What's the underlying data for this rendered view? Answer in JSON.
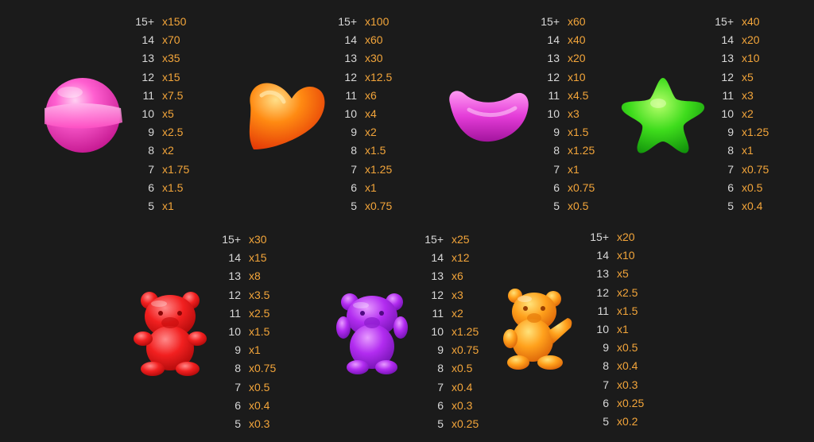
{
  "colors": {
    "background": "#1b1b1b",
    "count_text": "#d8d8d8",
    "multiplier_text": "#f3a53a"
  },
  "symbols": [
    {
      "icon": "pink-lollipop-icon",
      "rows": [
        {
          "count": "15+",
          "mult": "x150"
        },
        {
          "count": "14",
          "mult": "x70"
        },
        {
          "count": "13",
          "mult": "x35"
        },
        {
          "count": "12",
          "mult": "x15"
        },
        {
          "count": "11",
          "mult": "x7.5"
        },
        {
          "count": "10",
          "mult": "x5"
        },
        {
          "count": "9",
          "mult": "x2.5"
        },
        {
          "count": "8",
          "mult": "x2"
        },
        {
          "count": "7",
          "mult": "x1.75"
        },
        {
          "count": "6",
          "mult": "x1.5"
        },
        {
          "count": "5",
          "mult": "x1"
        }
      ]
    },
    {
      "icon": "orange-heart-candy-icon",
      "rows": [
        {
          "count": "15+",
          "mult": "x100"
        },
        {
          "count": "14",
          "mult": "x60"
        },
        {
          "count": "13",
          "mult": "x30"
        },
        {
          "count": "12",
          "mult": "x12.5"
        },
        {
          "count": "11",
          "mult": "x6"
        },
        {
          "count": "10",
          "mult": "x4"
        },
        {
          "count": "9",
          "mult": "x2"
        },
        {
          "count": "8",
          "mult": "x1.5"
        },
        {
          "count": "7",
          "mult": "x1.25"
        },
        {
          "count": "6",
          "mult": "x1"
        },
        {
          "count": "5",
          "mult": "x0.75"
        }
      ]
    },
    {
      "icon": "magenta-jellybean-icon",
      "rows": [
        {
          "count": "15+",
          "mult": "x60"
        },
        {
          "count": "14",
          "mult": "x40"
        },
        {
          "count": "13",
          "mult": "x20"
        },
        {
          "count": "12",
          "mult": "x10"
        },
        {
          "count": "11",
          "mult": "x4.5"
        },
        {
          "count": "10",
          "mult": "x3"
        },
        {
          "count": "9",
          "mult": "x1.5"
        },
        {
          "count": "8",
          "mult": "x1.25"
        },
        {
          "count": "7",
          "mult": "x1"
        },
        {
          "count": "6",
          "mult": "x0.75"
        },
        {
          "count": "5",
          "mult": "x0.5"
        }
      ]
    },
    {
      "icon": "green-star-candy-icon",
      "rows": [
        {
          "count": "15+",
          "mult": "x40"
        },
        {
          "count": "14",
          "mult": "x20"
        },
        {
          "count": "13",
          "mult": "x10"
        },
        {
          "count": "12",
          "mult": "x5"
        },
        {
          "count": "11",
          "mult": "x3"
        },
        {
          "count": "10",
          "mult": "x2"
        },
        {
          "count": "9",
          "mult": "x1.25"
        },
        {
          "count": "8",
          "mult": "x1"
        },
        {
          "count": "7",
          "mult": "x0.75"
        },
        {
          "count": "6",
          "mult": "x0.5"
        },
        {
          "count": "5",
          "mult": "x0.4"
        }
      ]
    },
    {
      "icon": "red-gummy-bear-icon",
      "rows": [
        {
          "count": "15+",
          "mult": "x30"
        },
        {
          "count": "14",
          "mult": "x15"
        },
        {
          "count": "13",
          "mult": "x8"
        },
        {
          "count": "12",
          "mult": "x3.5"
        },
        {
          "count": "11",
          "mult": "x2.5"
        },
        {
          "count": "10",
          "mult": "x1.5"
        },
        {
          "count": "9",
          "mult": "x1"
        },
        {
          "count": "8",
          "mult": "x0.75"
        },
        {
          "count": "7",
          "mult": "x0.5"
        },
        {
          "count": "6",
          "mult": "x0.4"
        },
        {
          "count": "5",
          "mult": "x0.3"
        }
      ]
    },
    {
      "icon": "purple-gummy-bear-icon",
      "rows": [
        {
          "count": "15+",
          "mult": "x25"
        },
        {
          "count": "14",
          "mult": "x12"
        },
        {
          "count": "13",
          "mult": "x6"
        },
        {
          "count": "12",
          "mult": "x3"
        },
        {
          "count": "11",
          "mult": "x2"
        },
        {
          "count": "10",
          "mult": "x1.25"
        },
        {
          "count": "9",
          "mult": "x0.75"
        },
        {
          "count": "8",
          "mult": "x0.5"
        },
        {
          "count": "7",
          "mult": "x0.4"
        },
        {
          "count": "6",
          "mult": "x0.3"
        },
        {
          "count": "5",
          "mult": "x0.25"
        }
      ]
    },
    {
      "icon": "orange-gummy-bear-icon",
      "rows": [
        {
          "count": "15+",
          "mult": "x20"
        },
        {
          "count": "14",
          "mult": "x10"
        },
        {
          "count": "13",
          "mult": "x5"
        },
        {
          "count": "12",
          "mult": "x2.5"
        },
        {
          "count": "11",
          "mult": "x1.5"
        },
        {
          "count": "10",
          "mult": "x1"
        },
        {
          "count": "9",
          "mult": "x0.5"
        },
        {
          "count": "8",
          "mult": "x0.4"
        },
        {
          "count": "7",
          "mult": "x0.3"
        },
        {
          "count": "6",
          "mult": "x0.25"
        },
        {
          "count": "5",
          "mult": "x0.2"
        }
      ]
    }
  ]
}
